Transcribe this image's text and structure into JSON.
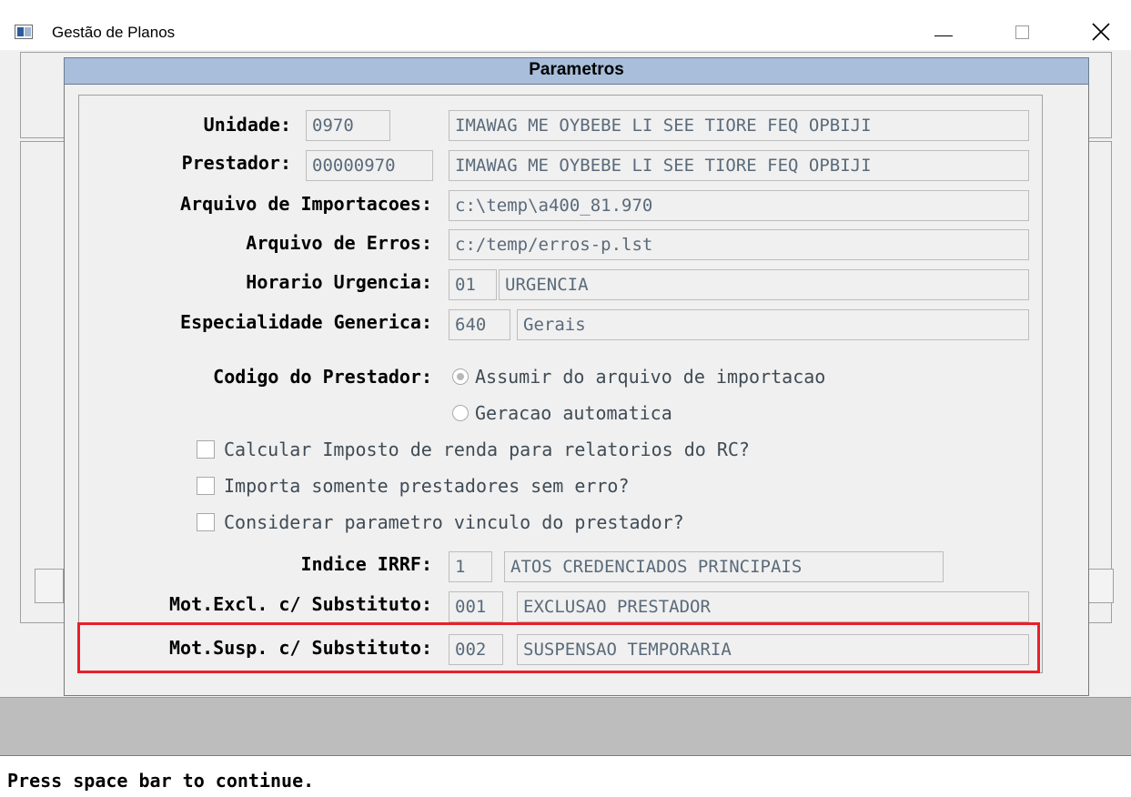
{
  "window": {
    "title": "Gestão de Planos"
  },
  "dialog": {
    "title": "Parametros"
  },
  "fields": {
    "unidade": {
      "label": "Unidade:",
      "code": "0970",
      "desc": "IMAWAG ME OYBEBE LI SEE TIORE FEQ OPBIJI"
    },
    "prestador": {
      "label": "Prestador:",
      "code": "00000970",
      "desc": "IMAWAG ME OYBEBE LI SEE TIORE FEQ OPBIJI"
    },
    "arquivo_importacoes": {
      "label": "Arquivo de Importacoes:",
      "value": "c:\\temp\\a400_81.970"
    },
    "arquivo_erros": {
      "label": "Arquivo de Erros:",
      "value": "c:/temp/erros-p.lst"
    },
    "horario_urgencia": {
      "label": "Horario Urgencia:",
      "code": "01",
      "desc": "URGENCIA"
    },
    "especialidade_generica": {
      "label": "Especialidade Generica:",
      "code": "640",
      "desc": "Gerais"
    },
    "codigo_prestador": {
      "label": "Codigo do Prestador:",
      "options": [
        "Assumir do arquivo de importacao",
        "Geracao automatica"
      ],
      "selected": "Assumir do arquivo de importacao"
    },
    "checkboxes": [
      {
        "label": "Calcular Imposto de renda para relatorios do RC?",
        "checked": false
      },
      {
        "label": "Importa somente prestadores sem erro?",
        "checked": false
      },
      {
        "label": "Considerar parametro vinculo do prestador?",
        "checked": false
      }
    ],
    "indice_irrf": {
      "label": "Indice IRRF:",
      "code": "1",
      "desc": "ATOS CREDENCIADOS PRINCIPAIS"
    },
    "mot_excl": {
      "label": "Mot.Excl. c/ Substituto:",
      "code": "001",
      "desc": "EXCLUSAO PRESTADOR"
    },
    "mot_susp": {
      "label": "Mot.Susp. c/ Substituto:",
      "code": "002",
      "desc": "SUSPENSAO TEMPORARIA"
    }
  },
  "status": {
    "text": "Press space bar to continue."
  },
  "colors": {
    "dialog_header": "#a8bedb",
    "highlight": "#e8202a",
    "field_text": "#5a6a7a"
  }
}
